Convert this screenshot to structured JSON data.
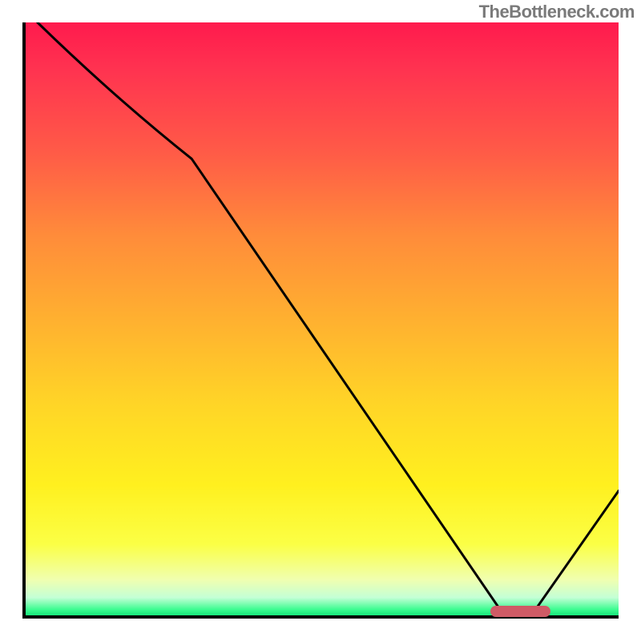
{
  "watermark": "TheBottleneck.com",
  "chart_data": {
    "type": "line",
    "title": "",
    "xlabel": "",
    "ylabel": "",
    "xlim": [
      0,
      100
    ],
    "ylim": [
      0,
      100
    ],
    "series": [
      {
        "name": "curve",
        "x": [
          2,
          28,
          80,
          86,
          100
        ],
        "y": [
          100,
          77,
          1,
          1,
          21
        ]
      }
    ],
    "marker": {
      "x_start": 78,
      "x_end": 88,
      "y": 1.2
    },
    "background_gradient": [
      "#ff1a4d",
      "#ff8c3a",
      "#ffd427",
      "#fbff45",
      "#18e67a"
    ],
    "notes": "Plot area spans full chart. Curve descends from top-left, bends at ~x=28, reaches minimum plateau ~x=80-86, rises toward right edge. Small rounded red-brown marker sits at the minimum. No axis ticks or numeric labels are rendered."
  },
  "styles": {
    "marker_color": "#cf5b66",
    "axis_color": "#000000"
  }
}
